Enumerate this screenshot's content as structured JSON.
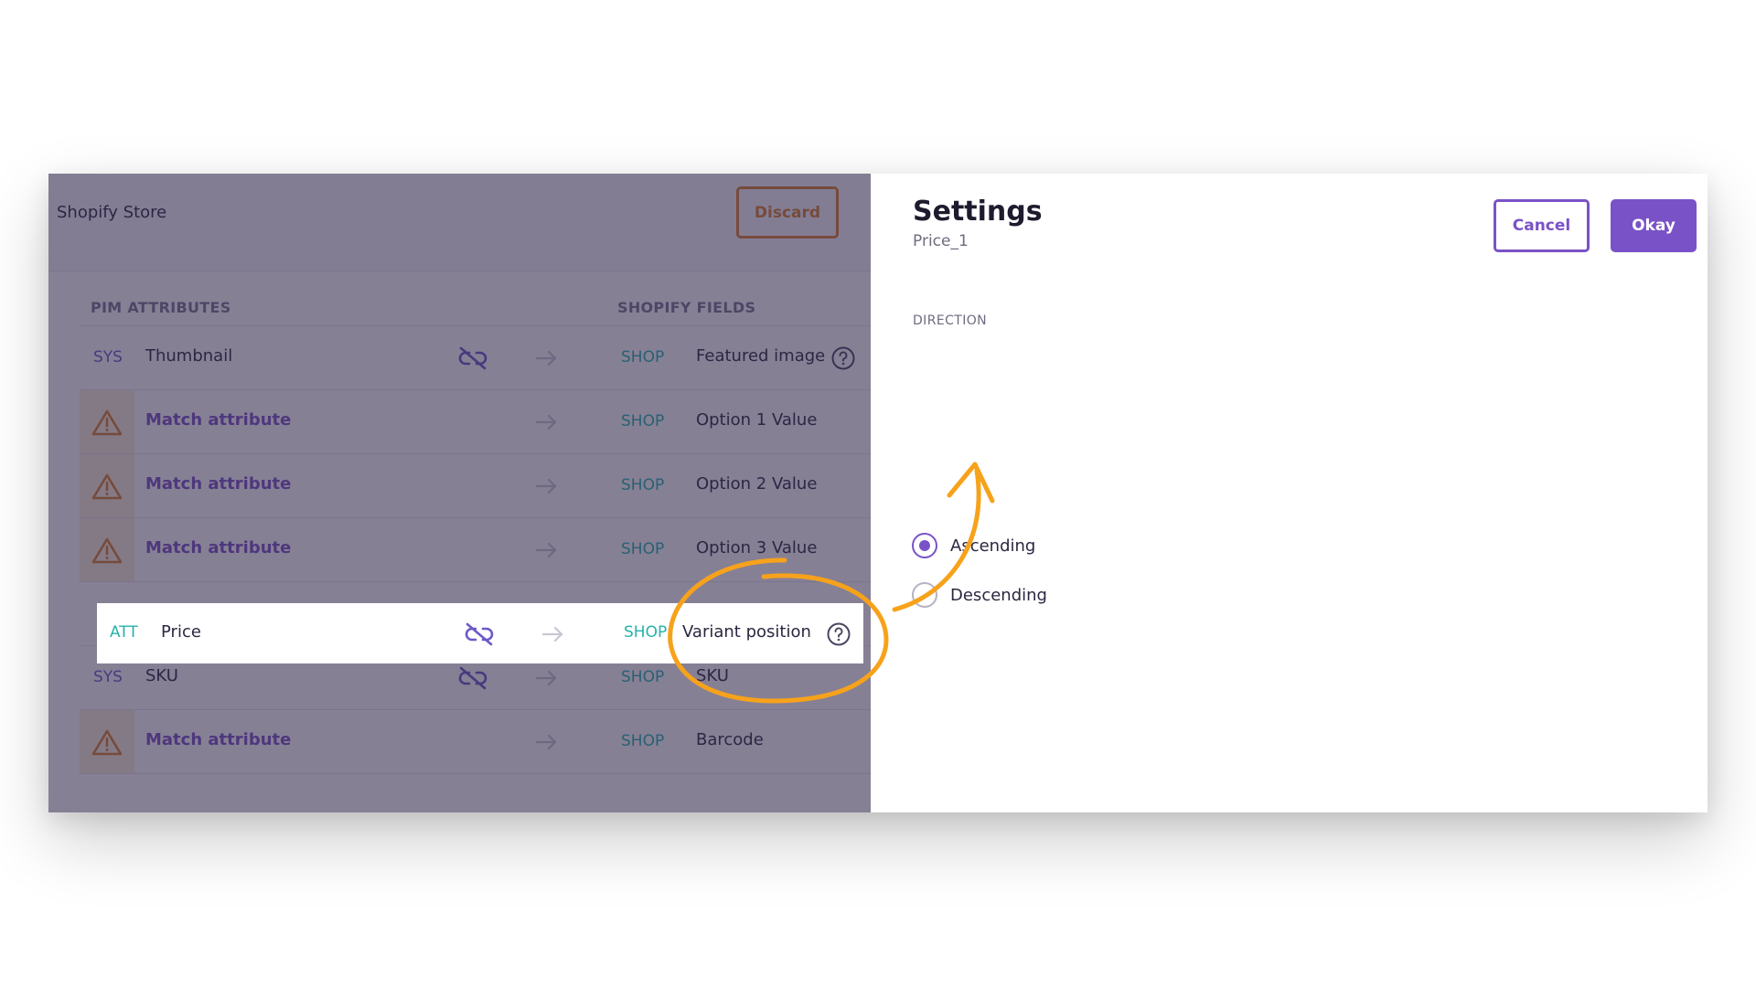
{
  "header": {
    "store_title": "Shopify Store",
    "discard_label": "Discard"
  },
  "table": {
    "col_pim": "PIM ATTRIBUTES",
    "col_shopify": "SHOPIFY FIELDS",
    "rows": [
      {
        "tag": "SYS",
        "attr": "Thumbnail",
        "shop_tag": "SHOP",
        "field": "Featured image"
      },
      {
        "tag": "",
        "attr": "Match attribute",
        "shop_tag": "SHOP",
        "field": "Option 1 Value"
      },
      {
        "tag": "",
        "attr": "Match attribute",
        "shop_tag": "SHOP",
        "field": "Option 2 Value"
      },
      {
        "tag": "",
        "attr": "Match attribute",
        "shop_tag": "SHOP",
        "field": "Option 3 Value"
      },
      {
        "tag": "ATT",
        "attr": "Price",
        "shop_tag": "SHOP",
        "field": "Variant position"
      },
      {
        "tag": "SYS",
        "attr": "SKU",
        "shop_tag": "SHOP",
        "field": "SKU"
      },
      {
        "tag": "",
        "attr": "Match attribute",
        "shop_tag": "SHOP",
        "field": "Barcode"
      }
    ]
  },
  "panel": {
    "title": "Settings",
    "subtitle": "Price_1",
    "cancel_label": "Cancel",
    "okay_label": "Okay",
    "direction_label": "DIRECTION",
    "options": [
      {
        "label": "Ascending",
        "selected": true
      },
      {
        "label": "Descending",
        "selected": false
      }
    ]
  },
  "colors": {
    "accent": "#7a52c7",
    "discard": "#d9822b",
    "shop_tag": "#25b3aa",
    "annotation": "#f7a21b"
  }
}
